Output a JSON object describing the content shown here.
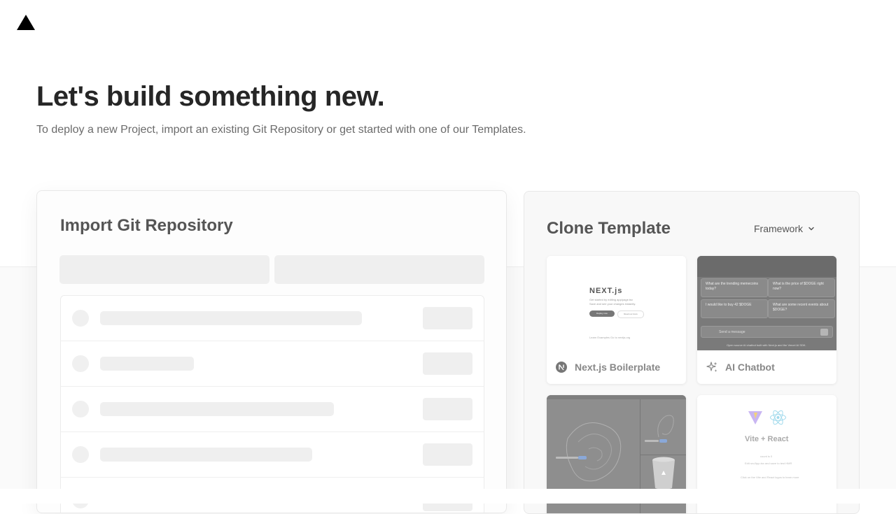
{
  "hero": {
    "title": "Let's build something new.",
    "subtitle": "To deploy a new Project, import an existing Git Repository or get started with one of our Templates."
  },
  "import_card": {
    "title": "Import Git Repository"
  },
  "clone_card": {
    "title": "Clone Template",
    "filter_label": "Framework",
    "templates": [
      {
        "label": "Next.js Boilerplate",
        "icon": "nextjs-icon",
        "thumb": {
          "logo": "NEXT.js",
          "line1": "Get started by editing app/page.tsx",
          "line2": "Save and see your changes instantly.",
          "btn1": "Deploy now",
          "btn2": "Read our docs",
          "links": "Learn  Examples  Go to nextjs.org"
        }
      },
      {
        "label": "AI Chatbot",
        "icon": "sparkles-icon",
        "thumb": {
          "q1": "What are the trending memecoins today?",
          "q2": "What is the price of $DOGE right now?",
          "q3": "I would like to buy 42 $DOGE",
          "q4": "What are some recent events about $DOGE?",
          "input": "Send a message",
          "note": "Open source AI chatbot built with Next.js and the Vercel AI SDK."
        }
      },
      {
        "label": "",
        "icon": ""
      },
      {
        "label": "",
        "icon": "",
        "thumb": {
          "title": "Vite + React",
          "line1": "count is 0",
          "line2": "Edit src/App.tsx and save to test HMR",
          "line3": "Click on the Vite and React logos to learn more"
        }
      }
    ]
  },
  "colors": {
    "heading": "#262626",
    "muted": "#6b6b6b",
    "skeleton": "#efefef",
    "card_border": "#e8e8e8"
  }
}
